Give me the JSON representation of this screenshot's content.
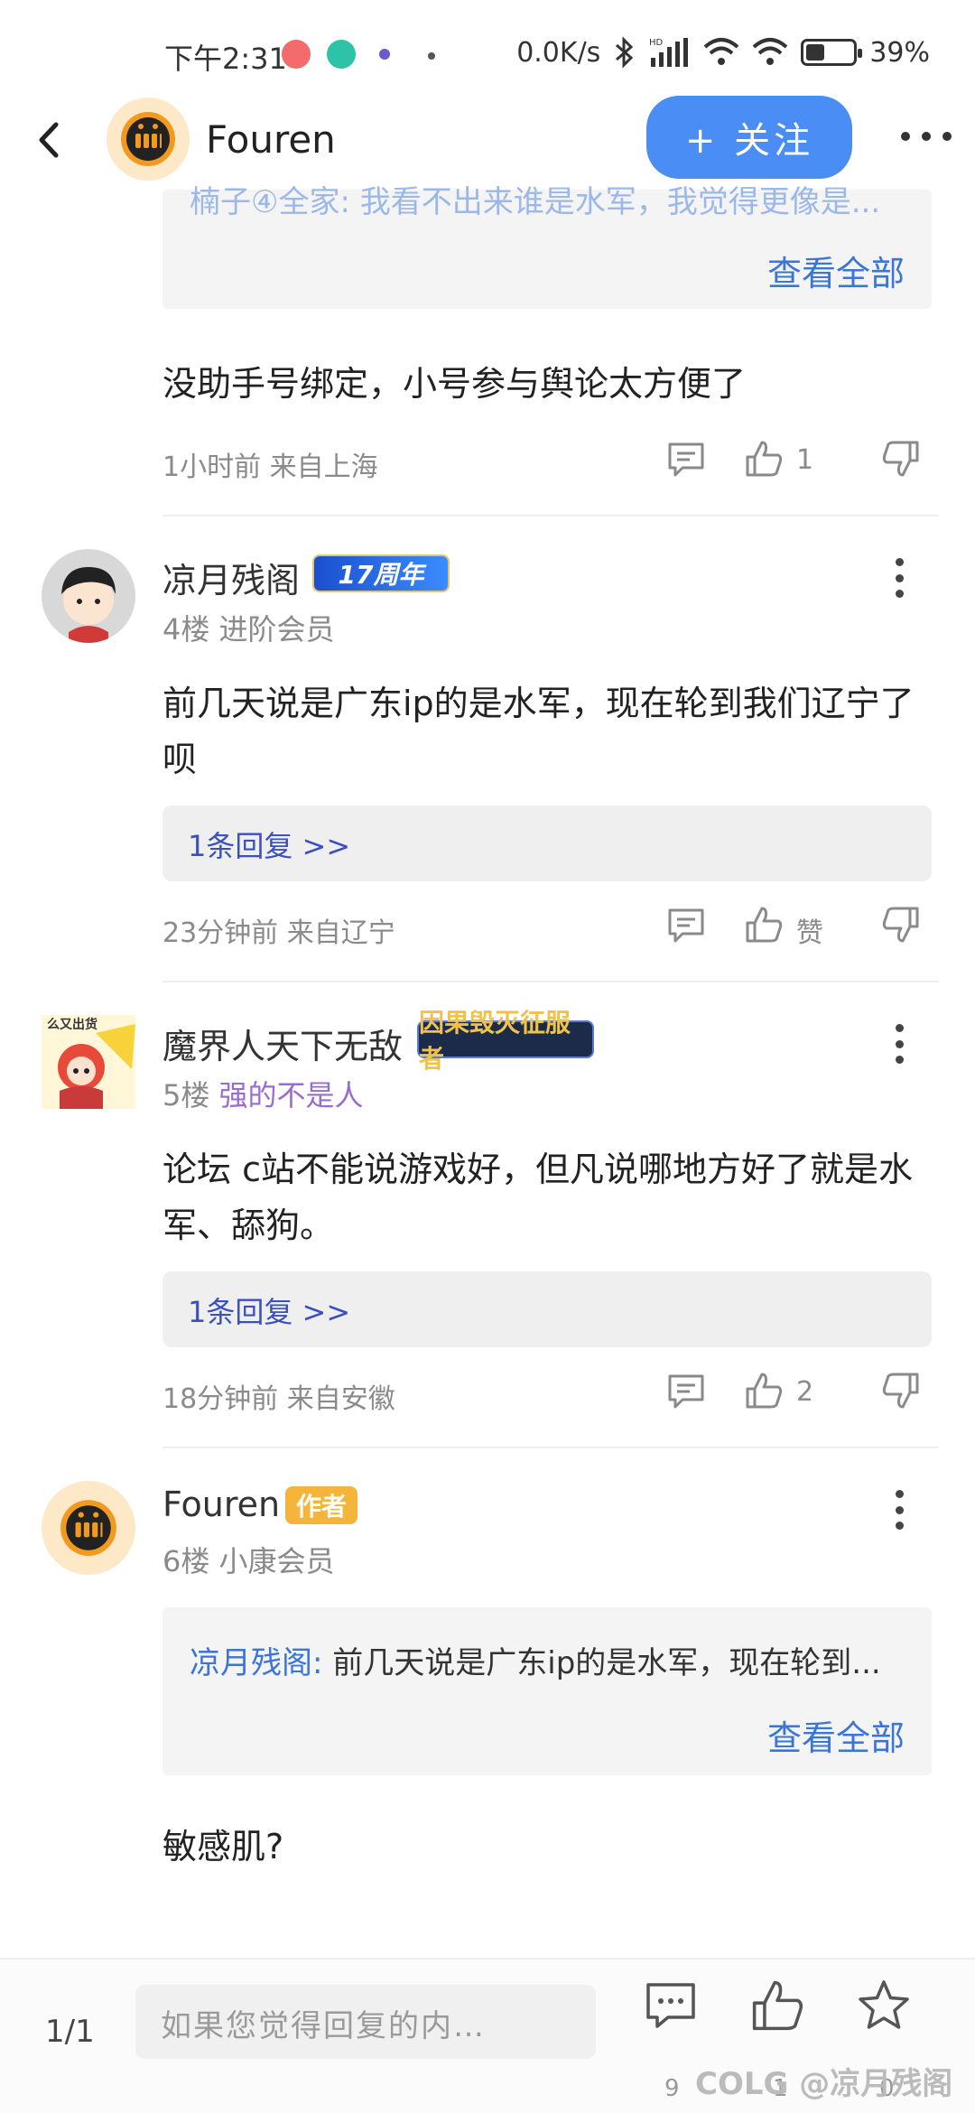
{
  "status_bar": {
    "time": "下午2:31",
    "network_speed": "0.0K/s",
    "battery": "39%",
    "battery_level": 0.39
  },
  "header": {
    "author_name": "Fouren",
    "follow_label": "+ 关注"
  },
  "top_quote": {
    "partial_line": "楠子④全家: 我看不出来谁是水军，我觉得更像是...",
    "view_all": "查看全部"
  },
  "comment_3": {
    "text": "没助手号绑定，小号参与舆论太方便了",
    "meta": "1小时前 来自上海",
    "like_count": "1"
  },
  "comment_4": {
    "username": "凉月残阁",
    "badge": "17周年",
    "floor": "4楼",
    "level": "进阶会员",
    "text": "前几天说是广东ip的是水军，现在轮到我们辽宁了呗",
    "replies": "1条回复 >>",
    "meta": "23分钟前 来自辽宁",
    "like_label": "赞"
  },
  "comment_5": {
    "username": "魔界人天下无敌",
    "badge": "因果毁灭征服者",
    "floor": "5楼",
    "level": "强的不是人",
    "avatar_caption": "么又出货",
    "text": "论坛 c站不能说游戏好，但凡说哪地方好了就是水军、舔狗。",
    "replies": "1条回复 >>",
    "meta": "18分钟前 来自安徽",
    "like_count": "2"
  },
  "comment_6": {
    "username": "Fouren",
    "badge": "作者",
    "floor": "6楼",
    "level": "小康会员",
    "quote_who": "凉月残阁:",
    "quote_text": " 前几天说是广东ip的是水军，现在轮到...",
    "view_all": "查看全部",
    "text": "敏感肌?"
  },
  "bottom_bar": {
    "page": "1/1",
    "input_placeholder": "如果您觉得回复的内…",
    "comment_count": "9",
    "like_count": "1",
    "star_count": "0",
    "watermark": "COLG @凉月残阁"
  },
  "colors": {
    "accent": "#4a8df4",
    "link": "#3b75d6",
    "author_badge": "#f5b53a",
    "meta_text": "#8a8a8a"
  }
}
